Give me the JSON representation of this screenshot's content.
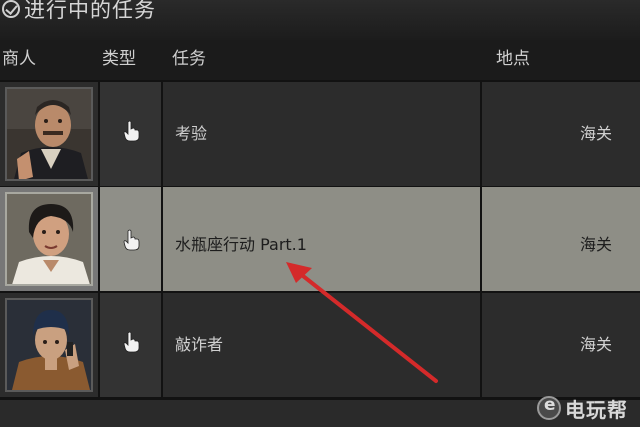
{
  "panel": {
    "title": "进行中的任务"
  },
  "columns": {
    "merchant": "商人",
    "type": "类型",
    "task": "任务",
    "location": "地点"
  },
  "rows": [
    {
      "task": "考验",
      "location": "海关",
      "type_icon": "hand-pointer-icon",
      "highlighted": false
    },
    {
      "task": "水瓶座行动 Part.1",
      "location": "海关",
      "type_icon": "hand-pointer-icon",
      "highlighted": true
    },
    {
      "task": "敲诈者",
      "location": "海关",
      "type_icon": "hand-pointer-icon",
      "highlighted": false
    }
  ],
  "watermark": {
    "text": "电玩帮"
  },
  "colors": {
    "background": "#121212",
    "row": "#2c2c2c",
    "highlight_row": "#8e8e86",
    "arrow": "#d42a2a"
  }
}
